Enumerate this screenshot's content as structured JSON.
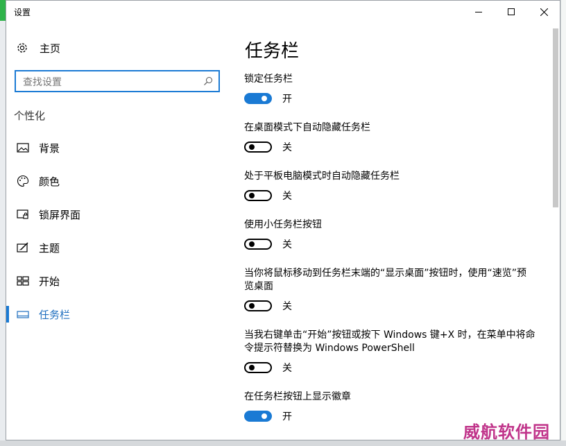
{
  "window": {
    "title": "设置"
  },
  "nav": {
    "home_label": "主页",
    "search_placeholder": "查找设置",
    "section_label": "个性化",
    "items": [
      {
        "label": "背景",
        "icon": "picture-icon",
        "active": false
      },
      {
        "label": "颜色",
        "icon": "palette-icon",
        "active": false
      },
      {
        "label": "锁屏界面",
        "icon": "lock-screen-icon",
        "active": false
      },
      {
        "label": "主题",
        "icon": "theme-brush-icon",
        "active": false
      },
      {
        "label": "开始",
        "icon": "start-tiles-icon",
        "active": false
      },
      {
        "label": "任务栏",
        "icon": "taskbar-icon",
        "active": true
      }
    ]
  },
  "main": {
    "title": "任务栏",
    "settings": [
      {
        "label": "锁定任务栏",
        "state": "开",
        "on": true
      },
      {
        "label": "在桌面模式下自动隐藏任务栏",
        "state": "关",
        "on": false
      },
      {
        "label": "处于平板电脑模式时自动隐藏任务栏",
        "state": "关",
        "on": false
      },
      {
        "label": "使用小任务栏按钮",
        "state": "关",
        "on": false
      },
      {
        "label": "当你将鼠标移动到任务栏末端的“显示桌面”按钮时，使用“速览”预览桌面",
        "state": "关",
        "on": false
      },
      {
        "label": "当我右键单击“开始”按钮或按下 Windows 键+X 时，在菜单中将命令提示符替换为 Windows PowerShell",
        "state": "关",
        "on": false
      },
      {
        "label": "在任务栏按钮上显示徽章",
        "state": "开",
        "on": true
      }
    ]
  },
  "watermark": "威航软件园",
  "colors": {
    "accent": "#1a7ad4",
    "watermark": "#c0348a"
  }
}
